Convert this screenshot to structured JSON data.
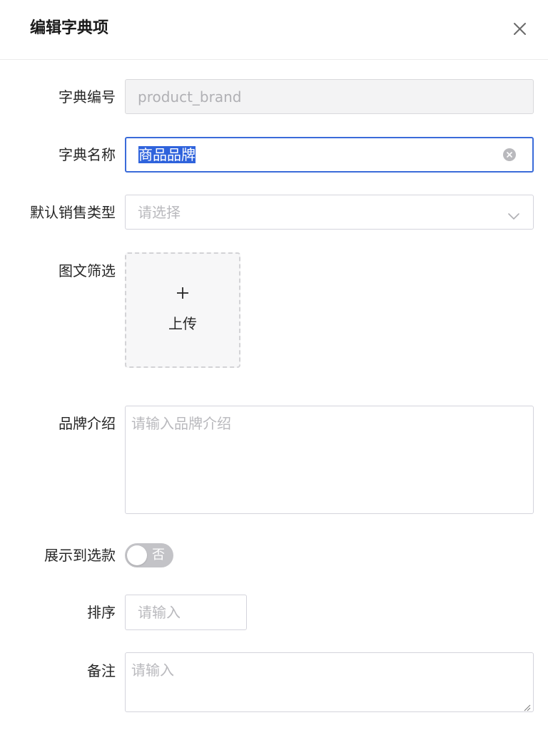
{
  "dialog": {
    "title": "编辑字典项"
  },
  "form": {
    "code": {
      "label": "字典编号",
      "value": "product_brand",
      "disabled": true
    },
    "name": {
      "label": "字典名称",
      "value": "商品品牌",
      "selected": true
    },
    "sales_type": {
      "label": "默认销售类型",
      "placeholder": "请选择"
    },
    "image_filter": {
      "label": "图文筛选",
      "upload_label": "上传"
    },
    "brand_intro": {
      "label": "品牌介绍",
      "placeholder": "请输入品牌介绍"
    },
    "show_in_selection": {
      "label": "展示到选款",
      "switch_text": "否",
      "on": false
    },
    "sort": {
      "label": "排序",
      "placeholder": "请输入"
    },
    "remark": {
      "label": "备注",
      "placeholder": "请输入"
    }
  },
  "colors": {
    "focus_border": "#3a6bd9",
    "selection_bg": "#2f63dc",
    "switch_off": "#c3c3c7"
  },
  "icons": {
    "close": "close-icon",
    "clear": "clear-circle-icon",
    "dropdown": "chevron-down-icon",
    "upload": "plus-icon",
    "resize": "resize-handle-icon"
  }
}
